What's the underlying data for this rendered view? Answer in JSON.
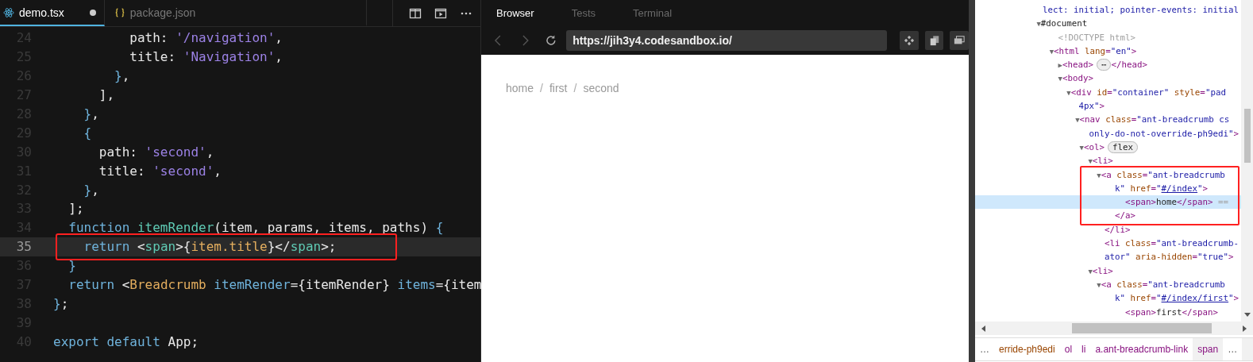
{
  "editor": {
    "tabs": [
      {
        "label": "demo.tsx",
        "kind": "react",
        "selected": true,
        "modified": true
      },
      {
        "label": "package.json",
        "kind": "json",
        "selected": false,
        "modified": false
      }
    ],
    "lines": [
      {
        "number": "24",
        "current": false,
        "tokens": [
          {
            "kind": "plain",
            "text": "          path"
          },
          {
            "kind": "plain",
            "text": ": "
          },
          {
            "kind": "str",
            "text": "'/navigation'"
          },
          {
            "kind": "plain",
            "text": ","
          }
        ]
      },
      {
        "number": "25",
        "current": false,
        "tokens": [
          {
            "kind": "plain",
            "text": "          title"
          },
          {
            "kind": "plain",
            "text": ": "
          },
          {
            "kind": "str",
            "text": "'Navigation'"
          },
          {
            "kind": "plain",
            "text": ","
          }
        ]
      },
      {
        "number": "26",
        "current": false,
        "tokens": [
          {
            "kind": "brace",
            "text": "        }"
          },
          {
            "kind": "plain",
            "text": ","
          }
        ]
      },
      {
        "number": "27",
        "current": false,
        "tokens": [
          {
            "kind": "plain",
            "text": "      ],"
          }
        ]
      },
      {
        "number": "28",
        "current": false,
        "tokens": [
          {
            "kind": "brace",
            "text": "    }"
          },
          {
            "kind": "plain",
            "text": ","
          }
        ]
      },
      {
        "number": "29",
        "current": false,
        "tokens": [
          {
            "kind": "brace",
            "text": "    {"
          }
        ]
      },
      {
        "number": "30",
        "current": false,
        "tokens": [
          {
            "kind": "plain",
            "text": "      path: "
          },
          {
            "kind": "str",
            "text": "'second'"
          },
          {
            "kind": "plain",
            "text": ","
          }
        ]
      },
      {
        "number": "31",
        "current": false,
        "tokens": [
          {
            "kind": "plain",
            "text": "      title: "
          },
          {
            "kind": "str",
            "text": "'second'"
          },
          {
            "kind": "plain",
            "text": ","
          }
        ]
      },
      {
        "number": "32",
        "current": false,
        "tokens": [
          {
            "kind": "brace",
            "text": "    }"
          },
          {
            "kind": "plain",
            "text": ","
          }
        ]
      },
      {
        "number": "33",
        "current": false,
        "tokens": [
          {
            "kind": "plain",
            "text": "  ];"
          }
        ]
      },
      {
        "number": "34",
        "current": false,
        "tokens": [
          {
            "kind": "kw",
            "text": "  function "
          },
          {
            "kind": "fn",
            "text": "itemRender"
          },
          {
            "kind": "plain",
            "text": "(item, params, items, paths) "
          },
          {
            "kind": "brace",
            "text": "{"
          }
        ]
      },
      {
        "number": "35",
        "current": true,
        "annotated": true,
        "tokens": [
          {
            "kind": "kw",
            "text": "    return "
          },
          {
            "kind": "plain",
            "text": "<"
          },
          {
            "kind": "tag",
            "text": "span"
          },
          {
            "kind": "plain",
            "text": ">{"
          },
          {
            "kind": "expr",
            "text": "item.title"
          },
          {
            "kind": "plain",
            "text": "}</"
          },
          {
            "kind": "tag",
            "text": "span"
          },
          {
            "kind": "plain",
            "text": ">;"
          }
        ]
      },
      {
        "number": "36",
        "current": false,
        "tokens": [
          {
            "kind": "brace",
            "text": "  }"
          }
        ]
      },
      {
        "number": "37",
        "current": false,
        "tokens": [
          {
            "kind": "kw",
            "text": "  return "
          },
          {
            "kind": "plain",
            "text": "<"
          },
          {
            "kind": "comp",
            "text": "Breadcrumb"
          },
          {
            "kind": "attr",
            "text": " itemRender"
          },
          {
            "kind": "plain",
            "text": "={itemRender} "
          },
          {
            "kind": "attr",
            "text": "items"
          },
          {
            "kind": "plain",
            "text": "={item"
          }
        ]
      },
      {
        "number": "38",
        "current": false,
        "tokens": [
          {
            "kind": "brace",
            "text": "}"
          },
          {
            "kind": "plain",
            "text": ";"
          }
        ]
      },
      {
        "number": "39",
        "current": false
      },
      {
        "number": "40",
        "current": false,
        "tokens": [
          {
            "kind": "kw",
            "text": "export default "
          },
          {
            "kind": "plain",
            "text": "App;"
          }
        ]
      }
    ]
  },
  "browser": {
    "tabs": [
      {
        "label": "Browser",
        "selected": true
      },
      {
        "label": "Tests",
        "selected": false
      },
      {
        "label": "Terminal",
        "selected": false
      }
    ],
    "url": "https://jih3y4.codesandbox.io/",
    "breadcrumb": [
      {
        "kind": "link",
        "text": "home"
      },
      {
        "kind": "separator",
        "text": "/"
      },
      {
        "kind": "link",
        "text": "first"
      },
      {
        "kind": "separator",
        "text": "/"
      },
      {
        "kind": "link",
        "text": "second"
      }
    ]
  },
  "devtools": {
    "lines": [
      {
        "selected": false,
        "tokens": [
          {
            "kind": "val",
            "text": "  lect: initial; pointer-events: initial"
          }
        ]
      },
      {
        "selected": false,
        "tokens": [
          {
            "kind": "arrow",
            "text": " ▼"
          },
          {
            "kind": "text",
            "text": "#document"
          }
        ]
      },
      {
        "selected": false,
        "tokens": [
          {
            "kind": "doc",
            "text": "     <!DOCTYPE html>"
          }
        ]
      },
      {
        "selected": false,
        "tokens": [
          {
            "kind": "arrow",
            "text": "    ▼"
          },
          {
            "kind": "tag",
            "text": "<html"
          },
          {
            "kind": "attr",
            "text": " lang"
          },
          {
            "kind": "tag",
            "text": "="
          },
          {
            "kind": "val",
            "text": "\"en\""
          },
          {
            "kind": "tag",
            "text": ">"
          }
        ]
      },
      {
        "selected": false,
        "tokens": [
          {
            "kind": "arrow",
            "text": "      ▶"
          },
          {
            "kind": "tag",
            "text": "<head>"
          },
          {
            "kind": "badge",
            "text": "⋯"
          },
          {
            "kind": "tag",
            "text": "</head>"
          }
        ]
      },
      {
        "selected": false,
        "tokens": [
          {
            "kind": "arrow",
            "text": "      ▼"
          },
          {
            "kind": "tag",
            "text": "<body>"
          }
        ]
      },
      {
        "selected": false,
        "tokens": [
          {
            "kind": "arrow",
            "text": "        ▼"
          },
          {
            "kind": "tag",
            "text": "<div"
          },
          {
            "kind": "attr",
            "text": " id"
          },
          {
            "kind": "tag",
            "text": "="
          },
          {
            "kind": "val",
            "text": "\"container\""
          },
          {
            "kind": "attr",
            "text": " style"
          },
          {
            "kind": "tag",
            "text": "="
          },
          {
            "kind": "val",
            "text": "\"pad"
          }
        ]
      },
      {
        "selected": false,
        "tokens": [
          {
            "kind": "val",
            "text": "         4px\""
          },
          {
            "kind": "tag",
            "text": ">"
          }
        ]
      },
      {
        "selected": false,
        "tokens": [
          {
            "kind": "arrow",
            "text": "          ▼"
          },
          {
            "kind": "tag",
            "text": "<nav"
          },
          {
            "kind": "attr",
            "text": " class"
          },
          {
            "kind": "tag",
            "text": "="
          },
          {
            "kind": "val",
            "text": "\"ant-breadcrumb cs"
          }
        ]
      },
      {
        "selected": false,
        "tokens": [
          {
            "kind": "val",
            "text": "           only-do-not-override-ph9edi\""
          },
          {
            "kind": "tag",
            "text": ">"
          }
        ]
      },
      {
        "selected": false,
        "tokens": [
          {
            "kind": "arrow",
            "text": "           ▼"
          },
          {
            "kind": "tag",
            "text": "<ol>"
          },
          {
            "kind": "badge",
            "text": "flex"
          }
        ]
      },
      {
        "selected": false,
        "tokens": [
          {
            "kind": "arrow",
            "text": "             ▼"
          },
          {
            "kind": "tag",
            "text": "<li>"
          }
        ]
      },
      {
        "selected": false,
        "annotated": true,
        "tokens": [
          {
            "kind": "arrow",
            "text": "               ▼"
          },
          {
            "kind": "tag",
            "text": "<a"
          },
          {
            "kind": "attr",
            "text": " class"
          },
          {
            "kind": "tag",
            "text": "="
          },
          {
            "kind": "val",
            "text": "\"ant-breadcrumb"
          }
        ]
      },
      {
        "selected": false,
        "annotated": true,
        "tokens": [
          {
            "kind": "val",
            "text": "                k\""
          },
          {
            "kind": "attr",
            "text": " href"
          },
          {
            "kind": "tag",
            "text": "="
          },
          {
            "kind": "val",
            "text": "\""
          },
          {
            "kind": "link",
            "text": "#/index"
          },
          {
            "kind": "val",
            "text": "\""
          },
          {
            "kind": "tag",
            "text": ">"
          }
        ]
      },
      {
        "selected": true,
        "annotated": true,
        "tokens": [
          {
            "kind": "tag",
            "text": "                  <span>"
          },
          {
            "kind": "text",
            "text": "home"
          },
          {
            "kind": "tag",
            "text": "</span>"
          },
          {
            "kind": "doc",
            "text": " =="
          }
        ]
      },
      {
        "selected": false,
        "annotated": true,
        "tokens": [
          {
            "kind": "tag",
            "text": "                </a>"
          }
        ]
      },
      {
        "selected": false,
        "tokens": [
          {
            "kind": "tag",
            "text": "              </li>"
          }
        ]
      },
      {
        "selected": false,
        "tokens": [
          {
            "kind": "tag",
            "text": "              <li"
          },
          {
            "kind": "attr",
            "text": " class"
          },
          {
            "kind": "tag",
            "text": "="
          },
          {
            "kind": "val",
            "text": "\"ant-breadcrumb-"
          }
        ]
      },
      {
        "selected": false,
        "tokens": [
          {
            "kind": "val",
            "text": "              ator\""
          },
          {
            "kind": "attr",
            "text": " aria-hidden"
          },
          {
            "kind": "tag",
            "text": "="
          },
          {
            "kind": "val",
            "text": "\"true\""
          },
          {
            "kind": "tag",
            "text": ">"
          }
        ]
      },
      {
        "selected": false,
        "tokens": [
          {
            "kind": "arrow",
            "text": "             ▼"
          },
          {
            "kind": "tag",
            "text": "<li>"
          }
        ]
      },
      {
        "selected": false,
        "tokens": [
          {
            "kind": "arrow",
            "text": "               ▼"
          },
          {
            "kind": "tag",
            "text": "<a"
          },
          {
            "kind": "attr",
            "text": " class"
          },
          {
            "kind": "tag",
            "text": "="
          },
          {
            "kind": "val",
            "text": "\"ant-breadcrumb"
          }
        ]
      },
      {
        "selected": false,
        "tokens": [
          {
            "kind": "val",
            "text": "                k\""
          },
          {
            "kind": "attr",
            "text": " href"
          },
          {
            "kind": "tag",
            "text": "="
          },
          {
            "kind": "val",
            "text": "\""
          },
          {
            "kind": "link",
            "text": "#/index/first"
          },
          {
            "kind": "val",
            "text": "\""
          },
          {
            "kind": "tag",
            "text": ">"
          }
        ]
      },
      {
        "selected": false,
        "tokens": [
          {
            "kind": "tag",
            "text": "                  <span>"
          },
          {
            "kind": "text",
            "text": "first"
          },
          {
            "kind": "tag",
            "text": "</span>"
          }
        ]
      }
    ],
    "path": [
      {
        "kind": "more",
        "text": "…",
        "selected": false
      },
      {
        "kind": "attr",
        "text": "erride-ph9edi",
        "selected": false
      },
      {
        "kind": "tag",
        "text": "ol",
        "selected": false
      },
      {
        "kind": "tag",
        "text": "li",
        "selected": false
      },
      {
        "kind": "tag",
        "text": "a.ant-breadcrumb-link",
        "selected": false
      },
      {
        "kind": "tag",
        "text": "span",
        "selected": true
      },
      {
        "kind": "more",
        "text": "…",
        "selected": false
      }
    ]
  }
}
